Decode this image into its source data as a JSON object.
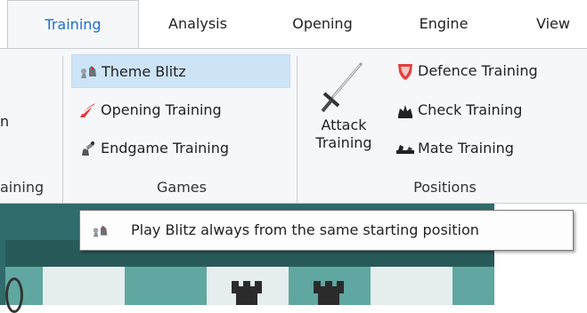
{
  "tabs": [
    {
      "label": "Training",
      "active": true
    },
    {
      "label": "Analysis"
    },
    {
      "label": "Opening"
    },
    {
      "label": "Engine"
    },
    {
      "label": "View"
    }
  ],
  "ribbon": {
    "left_group": {
      "partial_button": "n",
      "label": "aining"
    },
    "games": {
      "label": "Games",
      "items": [
        {
          "label": "Theme Blitz",
          "icon": "knight-blitz-icon",
          "highlighted": true
        },
        {
          "label": "Opening Training",
          "icon": "opening-training-icon"
        },
        {
          "label": "Endgame Training",
          "icon": "endgame-training-icon"
        }
      ]
    },
    "positions": {
      "label": "Positions",
      "attack_training": {
        "line1": "Attack",
        "line2": "Training",
        "icon": "sword-icon"
      },
      "items": [
        {
          "label": "Defence Training",
          "icon": "shield-icon"
        },
        {
          "label": "Check Training",
          "icon": "crown-icon"
        },
        {
          "label": "Mate Training",
          "icon": "mate-icon"
        }
      ]
    }
  },
  "tooltip": {
    "text": "Play Blitz always from the same starting position",
    "icon": "knight-blitz-icon"
  },
  "colors": {
    "accent": "#1e6fc9",
    "highlight": "#cde4f7",
    "board_dark": "#2f6b6a",
    "board_light": "#5fa7a0"
  }
}
